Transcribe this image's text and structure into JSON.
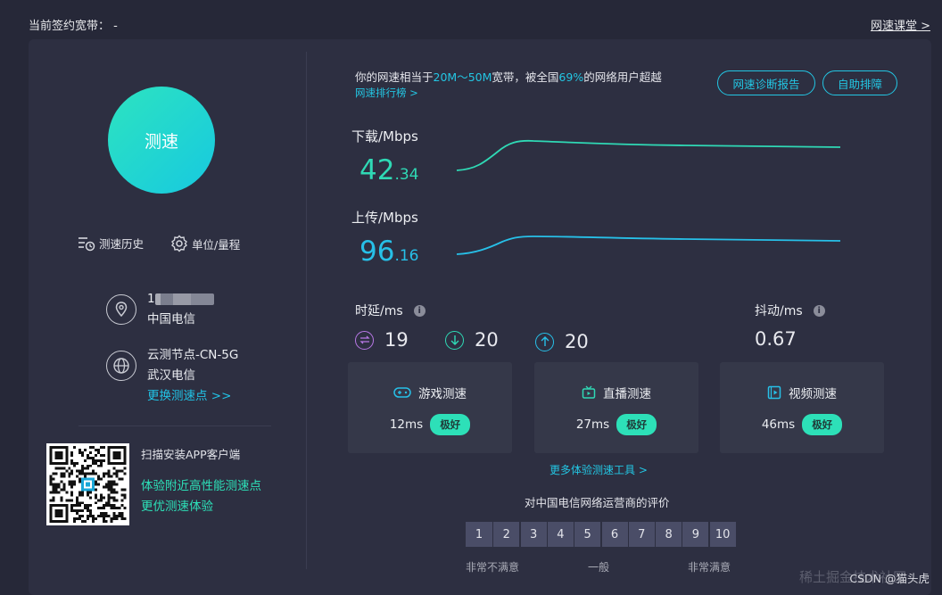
{
  "header": {
    "contract_label": "当前签约宽带：",
    "contract_value": "-",
    "course_link": "网速课堂 >"
  },
  "left": {
    "speed_button": "测速",
    "history": "测速历史",
    "unit": "单位/量程",
    "ip_tail": "1",
    "isp": "中国电信",
    "node_name": "云测节点-CN-5G",
    "node_isp": "武汉电信",
    "change_node": "更换测速点 >>",
    "qr_title": "扫描安装APP客户端",
    "qr_line1": "体验附近高性能测速点",
    "qr_line2": "更优测速体验"
  },
  "summary": {
    "prefix": "你的网速相当于",
    "bandwidth": "20M～50M",
    "mid": "宽带，被全国",
    "percent": "69%",
    "suffix": "的网络用户超越",
    "rank_link": "网速排行榜 >",
    "diagnose_button": "网速诊断报告",
    "self_fix_button": "自助排障"
  },
  "download": {
    "label": "下载/Mbps",
    "int": "42",
    "dec": ".34"
  },
  "upload": {
    "label": "上传/Mbps",
    "int": "96",
    "dec": ".16"
  },
  "latency": {
    "label": "时延/ms",
    "jitter_label": "抖动/ms",
    "exchange": "19",
    "down": "20",
    "up": "20",
    "jitter": "0.67"
  },
  "cards": [
    {
      "title": "游戏测速",
      "ms": "12ms",
      "badge": "极好"
    },
    {
      "title": "直播测速",
      "ms": "27ms",
      "badge": "极好"
    },
    {
      "title": "视频测速",
      "ms": "46ms",
      "badge": "极好"
    }
  ],
  "more_tools": "更多体验测速工具 >",
  "rating": {
    "title": "对中国电信网络运营商的评价",
    "scores": [
      "1",
      "2",
      "3",
      "4",
      "5",
      "6",
      "7",
      "8",
      "9",
      "10"
    ],
    "low": "非常不满意",
    "mid": "一般",
    "high": "非常满意"
  },
  "watermark": "CSDN @猫头虎",
  "watermark_ghost": "稀土掘金技术社区",
  "colors": {
    "accent": "#23c6e3",
    "download": "#2fd9b5",
    "upload": "#27c0e8",
    "panel": "#2d2f41"
  }
}
